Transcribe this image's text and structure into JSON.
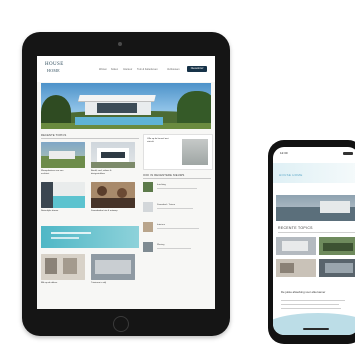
{
  "tablet": {
    "logo": {
      "line1": "HOUSE",
      "line2": "HOME"
    },
    "nav": [
      "Wonen",
      "Koken",
      "Interieur",
      "Tuin & buitenleven",
      "Verbouwen"
    ],
    "nav_cta": "Nieuwsbrief",
    "sections": {
      "recent": "RECENTE TOPICS",
      "aside": "OOK IN RECENTERE NIEUWS"
    },
    "cards": [
      {
        "title": "Woonplaatsen van een architect"
      },
      {
        "title": "Beeld, veel, videos & designstukken"
      },
      {
        "title": "Natuurlijke droom"
      },
      {
        "title": "Zwembaden tuin & ontwerp"
      },
      {
        "title": "Blik op de daken"
      },
      {
        "title": "Tuinieren in stijl"
      }
    ],
    "aside_items": [
      "Inrichting",
      "Zwembad - Tuinen",
      "Interieur",
      "Woning"
    ],
    "feature_title": "Villa op de heuvel met uitzicht"
  },
  "phone": {
    "status_time": "12:30",
    "brand": "HOUSE HOME",
    "section_title": "RECENTE TOPICS",
    "caption": "De juiste afwerking voor elke kamer",
    "colors": {
      "accent": "#5aa7c7",
      "wave": "#bcdde7"
    }
  },
  "colors": {
    "nav_cta": "#163248",
    "device": "#151515"
  }
}
